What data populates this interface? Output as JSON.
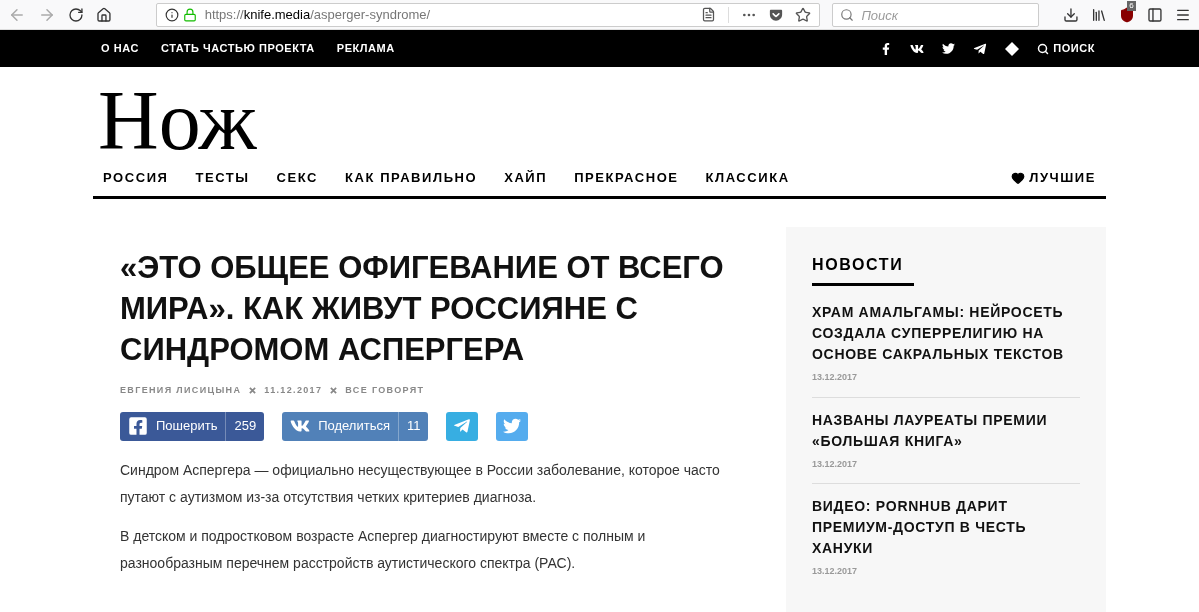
{
  "browser": {
    "url_scheme": "https://",
    "url_domain": "knife.media",
    "url_path": "/asperger-syndrome/",
    "search_placeholder": "Поиск",
    "badge": "6"
  },
  "topbar": {
    "links": [
      "О НАС",
      "СТАТЬ ЧАСТЬЮ ПРОЕКТА",
      "РЕКЛАМА"
    ],
    "search": "ПОИСК"
  },
  "logo": "Нож",
  "nav": {
    "items": [
      "РОССИЯ",
      "ТЕСТЫ",
      "СЕКС",
      "КАК ПРАВИЛЬНО",
      "ХАЙП",
      "ПРЕКРАСНОЕ",
      "КЛАССИКА"
    ],
    "best": "ЛУЧШИЕ"
  },
  "article": {
    "title": "«ЭТО ОБЩЕЕ ОФИГЕВАНИЕ ОТ ВСЕГО МИРА». КАК ЖИВУТ РОССИЯНЕ С СИНДРОМОМ АСПЕРГЕРА",
    "meta": [
      "ЕВГЕНИЯ ЛИСИЦЫНА",
      "11.12.2017",
      "ВСЕ ГОВОРЯТ"
    ],
    "share": [
      {
        "kind": "facebook",
        "label": "Пошерить",
        "count": "259"
      },
      {
        "kind": "vk",
        "label": "Поделиться",
        "count": "11"
      },
      {
        "kind": "telegram"
      },
      {
        "kind": "twitter"
      }
    ],
    "paragraphs": [
      "Синдром Аспергера — официально несуществующее в России заболевание, которое часто путают с аутизмом из-за отсутствия четких критериев диагноза.",
      "В детском и подростковом возрасте Аспергер диагностируют вместе с полным и разнообразным перечнем расстройств аутистического спектра (РАС)."
    ]
  },
  "sidebar": {
    "title": "НОВОСТИ",
    "news": [
      {
        "title": "ХРАМ АМАЛЬГАМЫ: НЕЙРОСЕТЬ СОЗДАЛА СУПЕРРЕЛИГИЮ НА ОСНОВЕ САКРАЛЬНЫХ ТЕКСТОВ",
        "date": "13.12.2017"
      },
      {
        "title": "НАЗВАНЫ ЛАУРЕАТЫ ПРЕМИИ «БОЛЬШАЯ КНИГА»",
        "date": "13.12.2017"
      },
      {
        "title": "ВИДЕО: PORNHUB ДАРИТ ПРЕМИУМ-ДОСТУП В ЧЕСТЬ ХАНУКИ",
        "date": "13.12.2017"
      }
    ]
  }
}
